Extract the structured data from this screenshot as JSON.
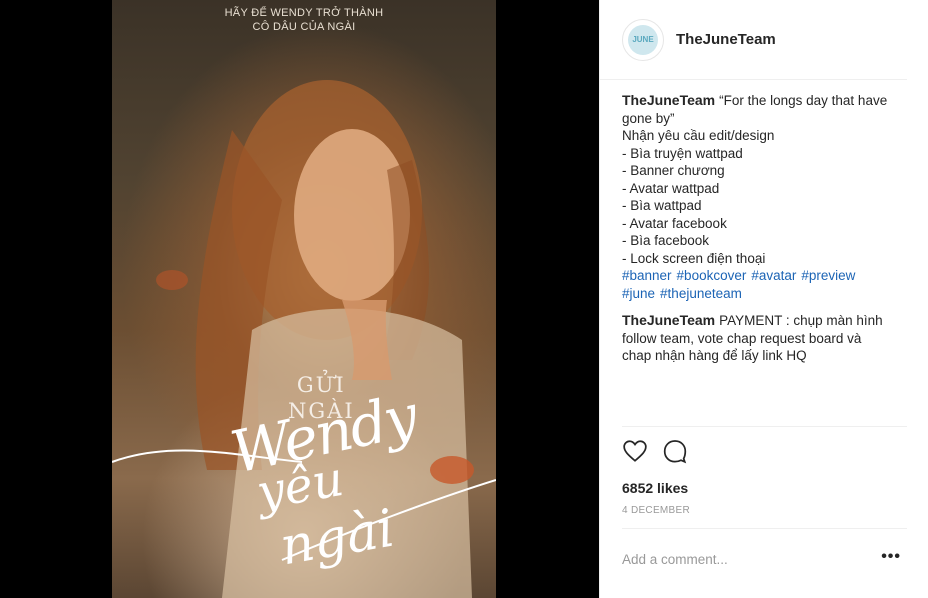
{
  "poster": {
    "tagline_line1": "HÃY ĐỂ WENDY TRỞ THÀNH",
    "tagline_line2": "CÔ DÂU CỦA NGÀI",
    "gui_ngai_line1": "GỬI",
    "gui_ngai_line2": "NGÀI",
    "script_line1": "Wendy",
    "script_line2": "yêu",
    "script_line3": "ngài"
  },
  "header": {
    "avatar_text": "JUNE",
    "username": "TheJuneTeam"
  },
  "comments": [
    {
      "user": "TheJuneTeam",
      "text": "“For the longs day that have gone by”\nNhận yêu cầu edit/design\n- Bìa truyện wattpad\n- Banner chương\n- Avatar wattpad\n- Bìa wattpad\n- Avatar facebook\n- Bìa facebook\n- Lock screen điện thoại",
      "hashtags": [
        "#banner",
        "#bookcover",
        "#avatar",
        "#preview",
        "#june",
        "#thejuneteam"
      ]
    },
    {
      "user": "TheJuneTeam",
      "text": "PAYMENT : chụp màn hình follow team, vote chap request board và chap nhận hàng để lấy link HQ"
    }
  ],
  "actions": {
    "like_icon": "heart-icon",
    "comment_icon": "comment-icon"
  },
  "likes": "6852 likes",
  "date": "4 DECEMBER",
  "add_comment_placeholder": "Add a comment...",
  "more_label": "•••",
  "colors": {
    "hashtag": "#1c64b5",
    "text": "#262626",
    "muted": "#999999"
  }
}
